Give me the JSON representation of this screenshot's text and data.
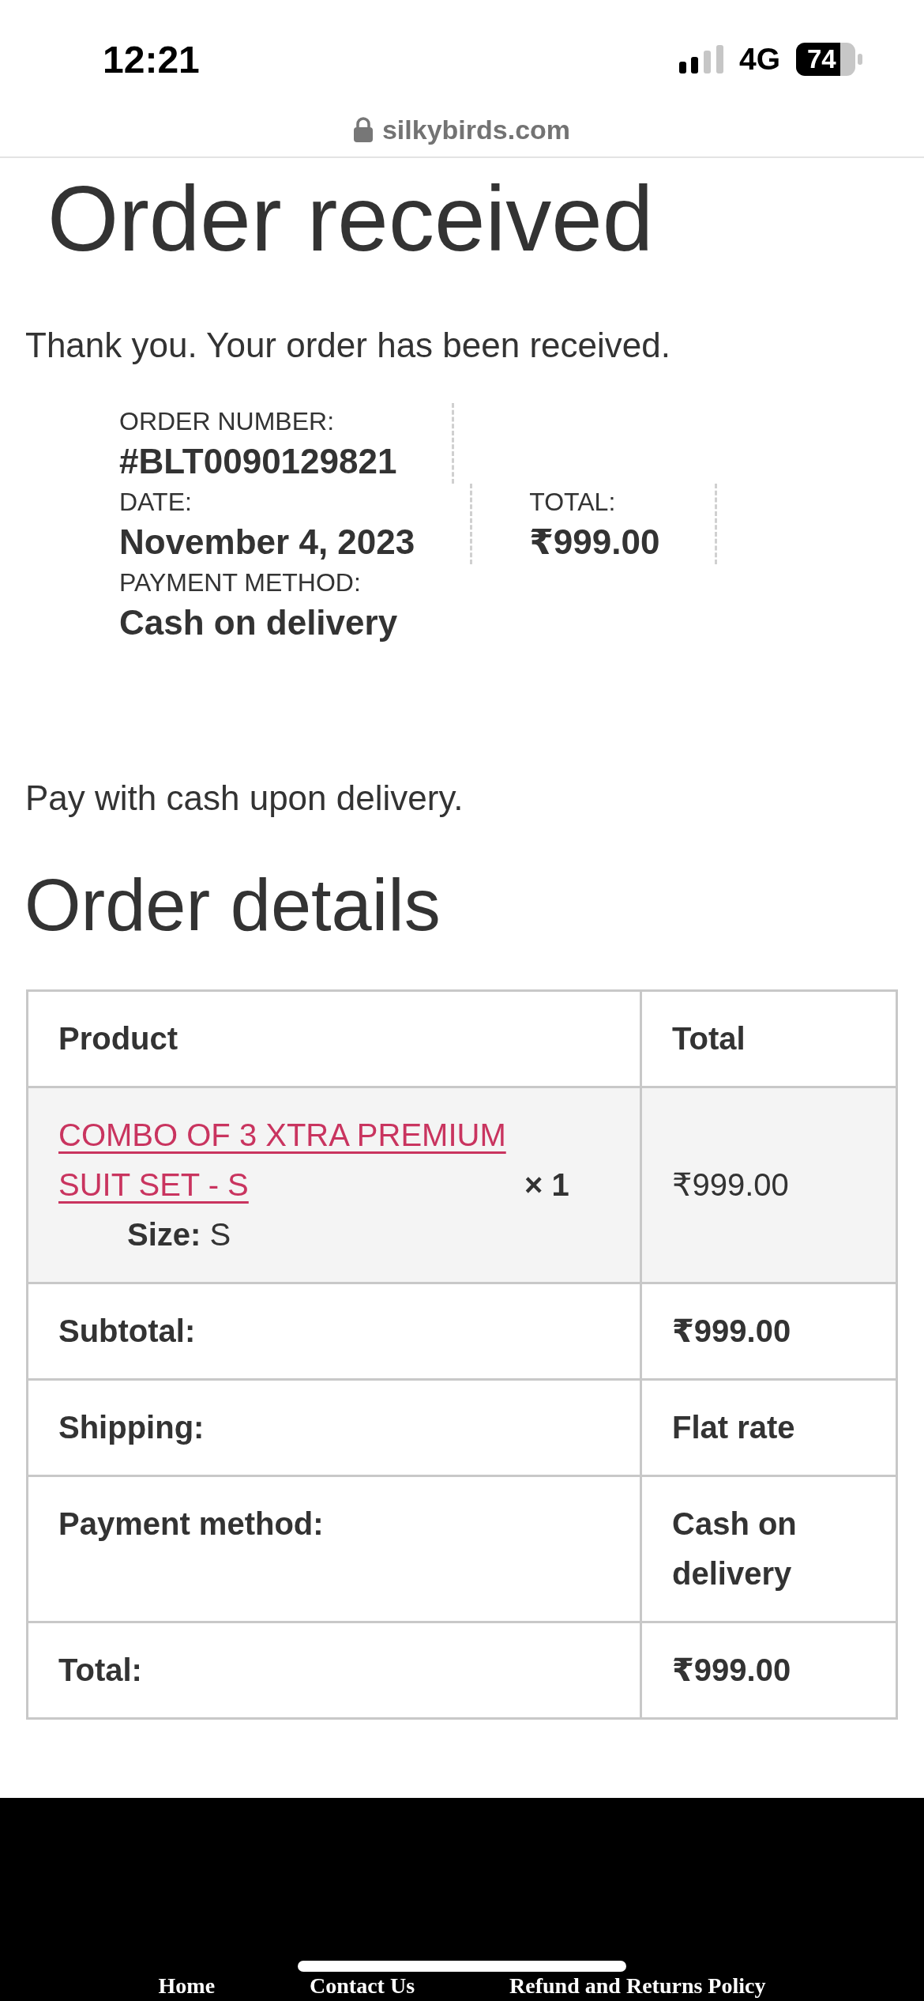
{
  "status_bar": {
    "time": "12:21",
    "network": "4G",
    "battery": "74"
  },
  "address_bar": {
    "url": "silkybirds.com"
  },
  "page": {
    "title": "Order received",
    "thank_you": "Thank you. Your order has been received."
  },
  "order_overview": [
    {
      "label": "ORDER NUMBER:",
      "value": "#BLT0090129821"
    },
    {
      "label": "DATE:",
      "value": "November 4, 2023"
    },
    {
      "label": "TOTAL:",
      "value": "₹999.00"
    },
    {
      "label": "PAYMENT METHOD:",
      "value": "Cash on delivery"
    }
  ],
  "payment_note": "Pay with cash upon delivery.",
  "order_details": {
    "title": "Order details",
    "columns": [
      "Product",
      "Total"
    ],
    "items": [
      {
        "name": "COMBO OF 3 XTRA PREMIUM SUIT SET - S",
        "quantity": "× 1",
        "meta": "**Size:** S",
        "total": "₹999.00"
      }
    ],
    "totals": [
      {
        "label": "Subtotal:",
        "value": "₹999.00"
      },
      {
        "label": "Shipping:",
        "value": "Flat rate"
      },
      {
        "label": "Payment method:",
        "value": "Cash on delivery"
      },
      {
        "label": "Total:",
        "value": "₹999.00"
      }
    ]
  },
  "footer": {
    "links": [
      "Home",
      "Contact Us",
      "Refund and Returns Policy"
    ]
  }
}
